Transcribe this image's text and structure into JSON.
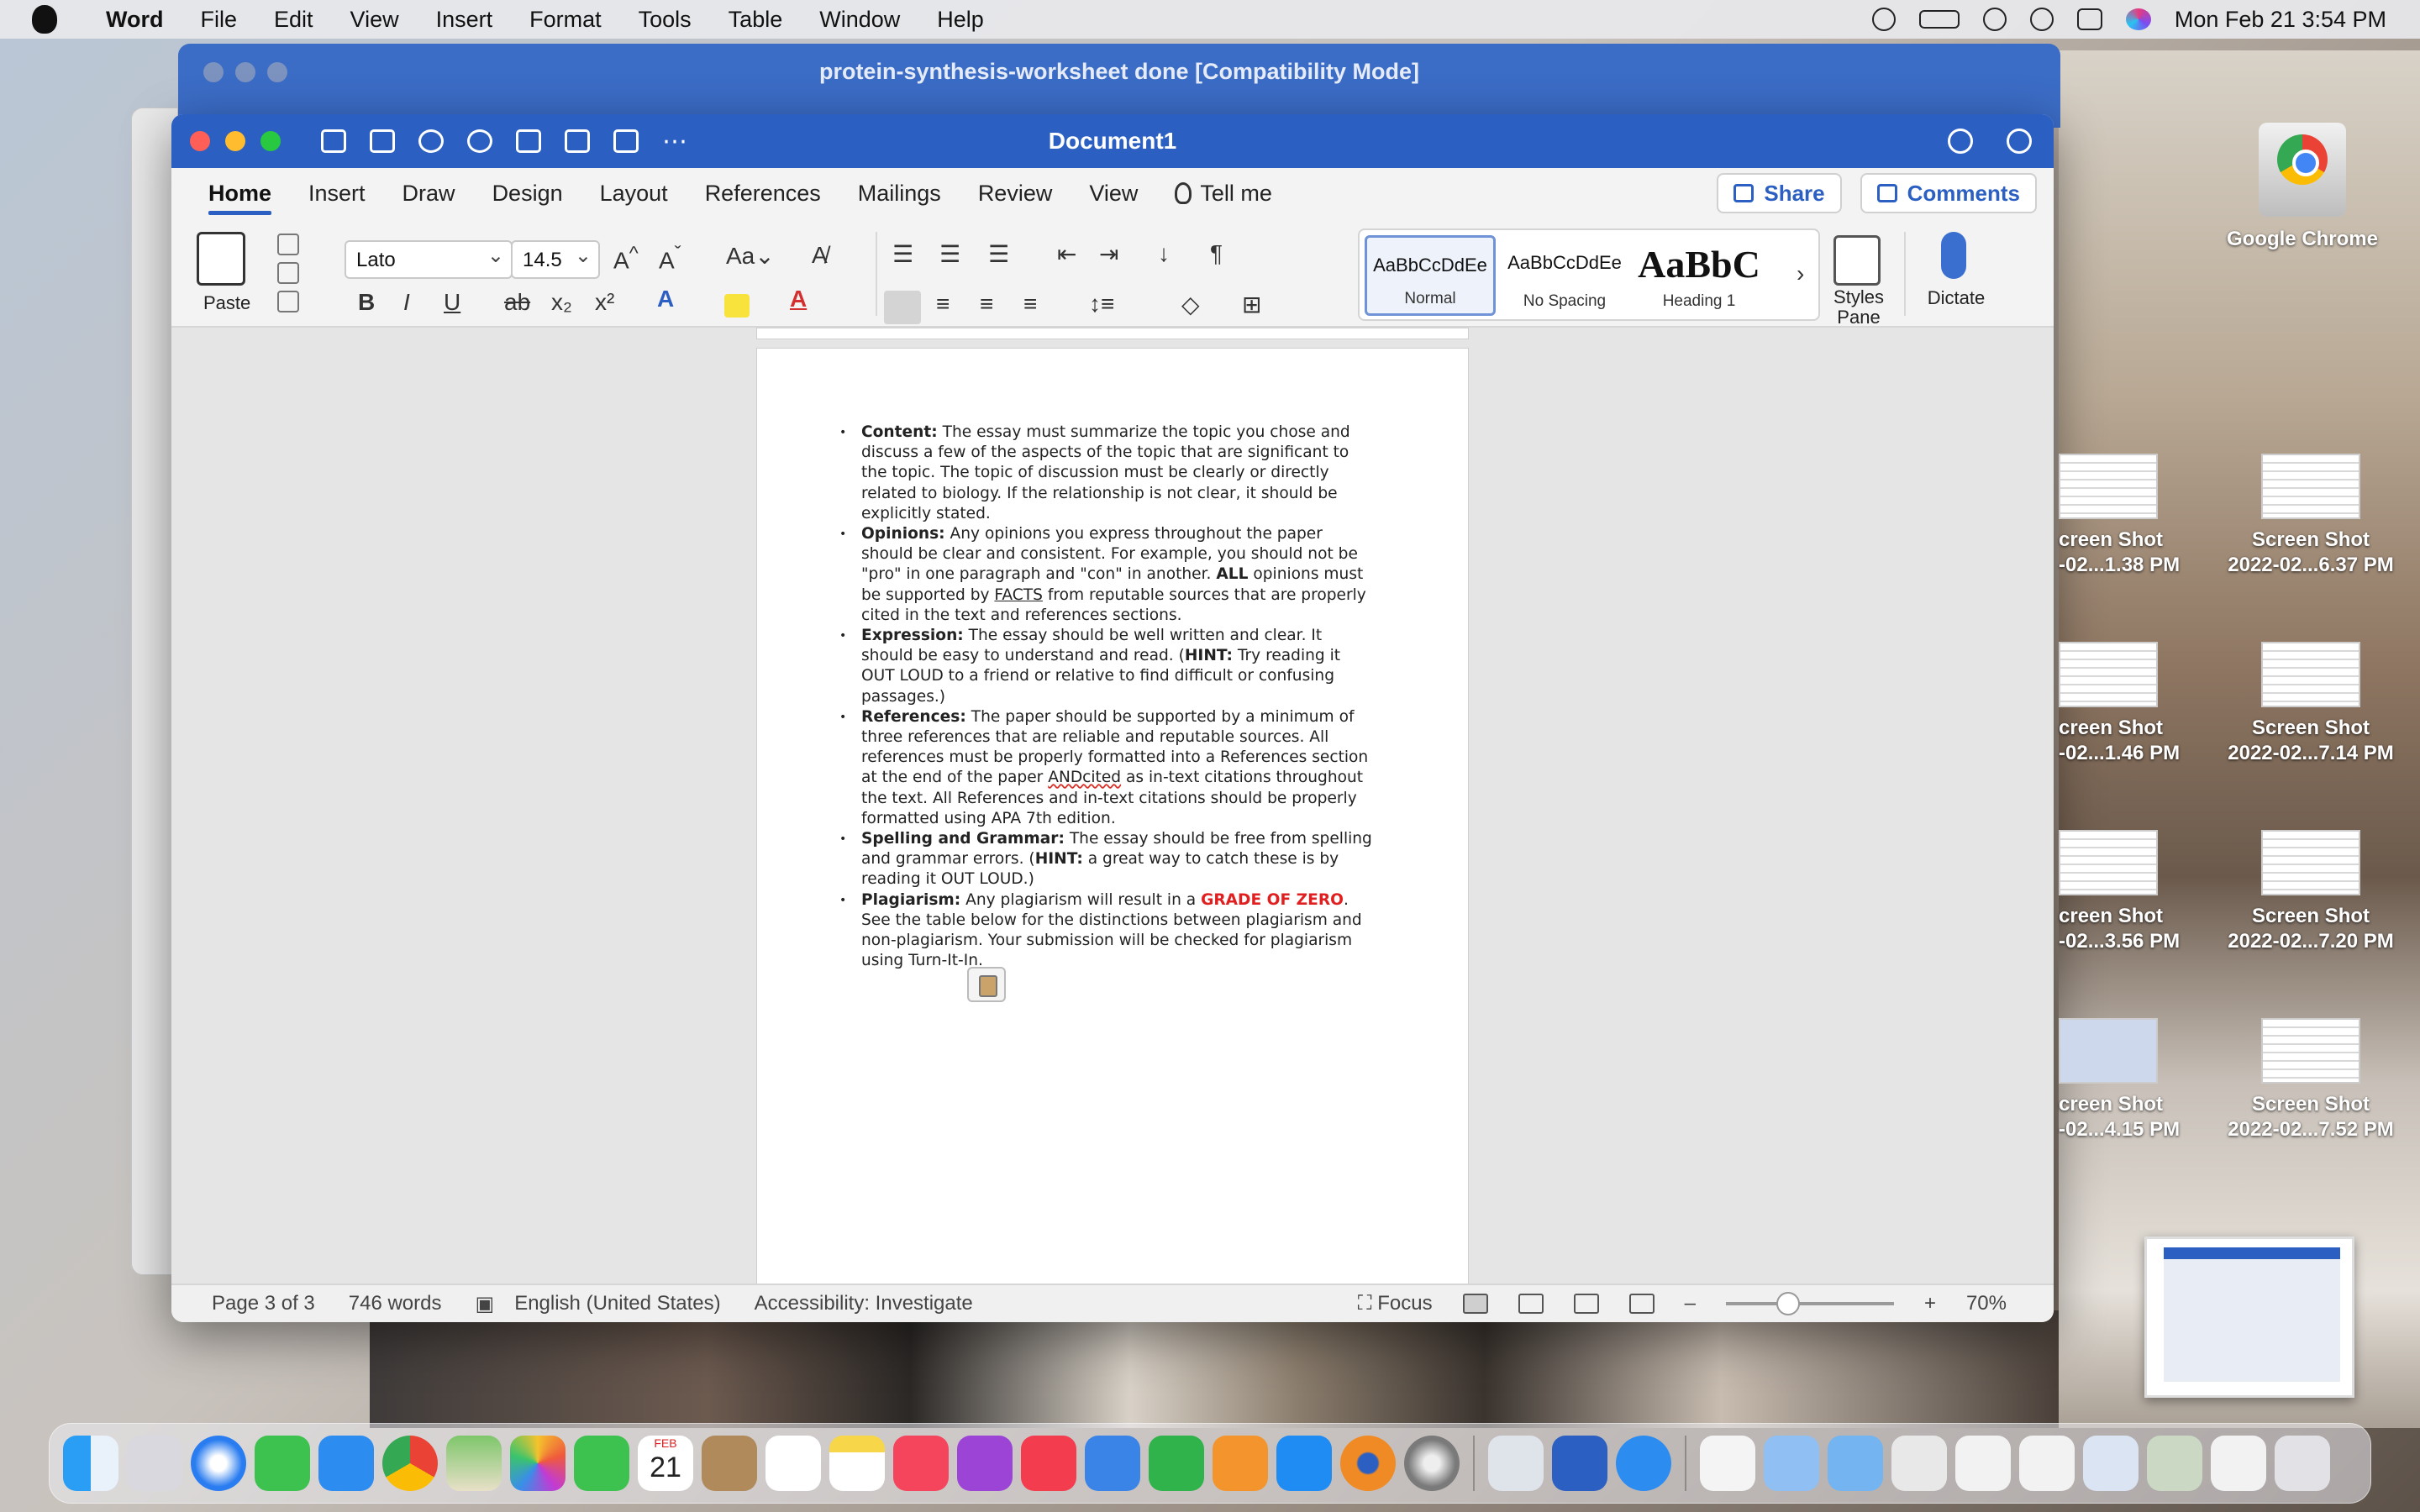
{
  "menubar": {
    "app_name": "Word",
    "items": [
      "File",
      "Edit",
      "View",
      "Insert",
      "Format",
      "Tools",
      "Table",
      "Window",
      "Help"
    ],
    "clock": "Mon Feb 21  3:54 PM"
  },
  "back_window": {
    "title": "protein-synthesis-worksheet done [Compatibility Mode]"
  },
  "main_window": {
    "title": "Document1",
    "tabs": [
      "Home",
      "Insert",
      "Draw",
      "Design",
      "Layout",
      "References",
      "Mailings",
      "Review",
      "View"
    ],
    "active_tab": "Home",
    "tell_me": "Tell me",
    "share_label": "Share",
    "comments_label": "Comments"
  },
  "ribbon": {
    "paste_label": "Paste",
    "font_name": "Lato",
    "font_size": "14.5",
    "styles": [
      {
        "sample": "AaBbCcDdEe",
        "name": "Normal"
      },
      {
        "sample": "AaBbCcDdEe",
        "name": "No Spacing"
      },
      {
        "sample": "AaBbC",
        "name": "Heading 1"
      }
    ],
    "styles_pane_label": "Styles Pane",
    "dictate_label": "Dictate"
  },
  "document": {
    "bullets": [
      {
        "label": "Content:",
        "text": " The essay must summarize the topic you chose and discuss a few of the aspects of the topic that are significant to the topic. The topic of discussion must be clearly or directly related to biology. If the relationship is not clear, it should be explicitly stated."
      },
      {
        "label": "Opinions:",
        "text_a": " Any opinions you express throughout the paper should be clear and consistent. For example, you should not be \"pro\" in one paragraph and \"con\" in another. ",
        "bold_mid": "ALL",
        "text_b": " opinions must be supported by ",
        "underlined": "FACTS",
        "text_c": " from reputable sources that are properly cited in the text and references sections."
      },
      {
        "label": "Expression:",
        "text_a": " The essay should be well written and clear. It should be easy to understand and read. (",
        "hint": "HINT:",
        "text_b": " Try reading it OUT LOUD to a friend or relative to find difficult or confusing passages.)"
      },
      {
        "label": "References:",
        "text_a": " The paper should be supported by a minimum of three references that are reliable and reputable sources. All references must be properly formatted into a References section at the end of the paper ",
        "squiggle": "ANDcited",
        "text_b": " as in-text citations throughout the text. All References and in-text citations should be properly formatted using APA 7th edition."
      },
      {
        "label": "Spelling and Grammar:",
        "text_a": " The essay should be free from spelling and grammar errors. (",
        "hint": "HINT:",
        "text_b": " a great way to catch these is by reading it OUT LOUD.)"
      },
      {
        "label": "Plagiarism:",
        "text_a": " Any plagiarism will result in a ",
        "red": "GRADE OF ZERO",
        "text_b": ". See the table below for the distinctions between plagiarism and non-plagiarism. Your submission will be checked for plagiarism using Turn-It-In."
      }
    ]
  },
  "statusbar": {
    "page": "Page 3 of 3",
    "words": "746 words",
    "language": "English (United States)",
    "accessibility": "Accessibility: Investigate",
    "focus": "Focus",
    "zoom": "70%",
    "zoom_minus": "–",
    "zoom_plus": "+"
  },
  "desktop": {
    "chrome_label": "Google Chrome",
    "screenshots": [
      {
        "line1": "creen Shot",
        "line2": "-02...1.38 PM"
      },
      {
        "line1": "Screen Shot",
        "line2": "2022-02...6.37 PM"
      },
      {
        "line1": "creen Shot",
        "line2": "-02...1.46 PM"
      },
      {
        "line1": "Screen Shot",
        "line2": "2022-02...7.14 PM"
      },
      {
        "line1": "creen Shot",
        "line2": "-02...3.56 PM"
      },
      {
        "line1": "Screen Shot",
        "line2": "2022-02...7.20 PM"
      },
      {
        "line1": "creen Shot",
        "line2": "-02...4.15 PM"
      },
      {
        "line1": "Screen Shot",
        "line2": "2022-02...7.52 PM"
      }
    ]
  },
  "dock": {
    "apps": [
      "finder-icon",
      "launchpad-icon",
      "safari-icon",
      "messages-icon",
      "mail-icon",
      "chrome-icon",
      "maps-icon",
      "photos-icon",
      "facetime-icon",
      "calendar-icon",
      "contacts-icon",
      "reminders-icon",
      "notes-icon",
      "music-icon",
      "podcasts-icon",
      "news-icon",
      "keynote-icon",
      "numbers-icon",
      "pages-icon",
      "app-store-icon",
      "blender-icon",
      "system-preferences-icon"
    ],
    "calendar_month": "FEB",
    "calendar_day": "21"
  }
}
